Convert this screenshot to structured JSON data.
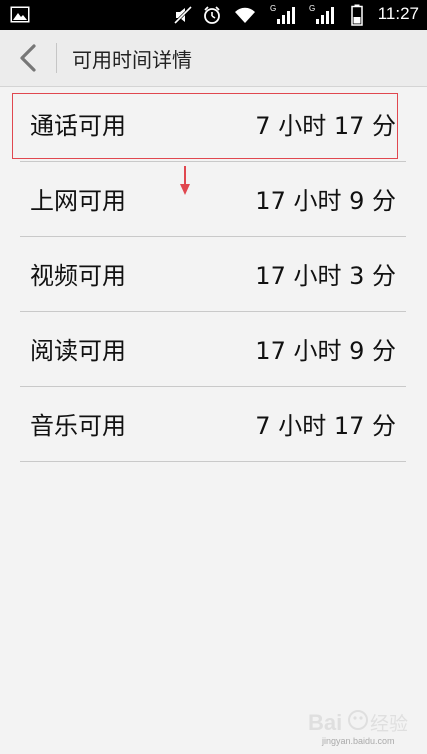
{
  "status_bar": {
    "time": "11:27",
    "network_1_label": "G",
    "network_2_label": "G",
    "icons": [
      "image-icon",
      "mute-icon",
      "alarm-icon",
      "wifi-icon",
      "signal-1-icon",
      "signal-2-icon",
      "battery-icon"
    ]
  },
  "header": {
    "title": "可用时间详情",
    "back_icon": "chevron-left-icon"
  },
  "items": [
    {
      "label": "通话可用",
      "value": "7 小时 17 分"
    },
    {
      "label": "上网可用",
      "value": "17 小时 9 分"
    },
    {
      "label": "视频可用",
      "value": "17 小时 3 分"
    },
    {
      "label": "阅读可用",
      "value": "17 小时 9 分"
    },
    {
      "label": "音乐可用",
      "value": "7 小时 17 分"
    }
  ],
  "annotation": {
    "highlight_color": "#e0474f",
    "arrow_color": "#e0474f"
  },
  "watermark": {
    "logo_text": "Bai 经验",
    "sub_text": "jingyan.baidu.com"
  }
}
